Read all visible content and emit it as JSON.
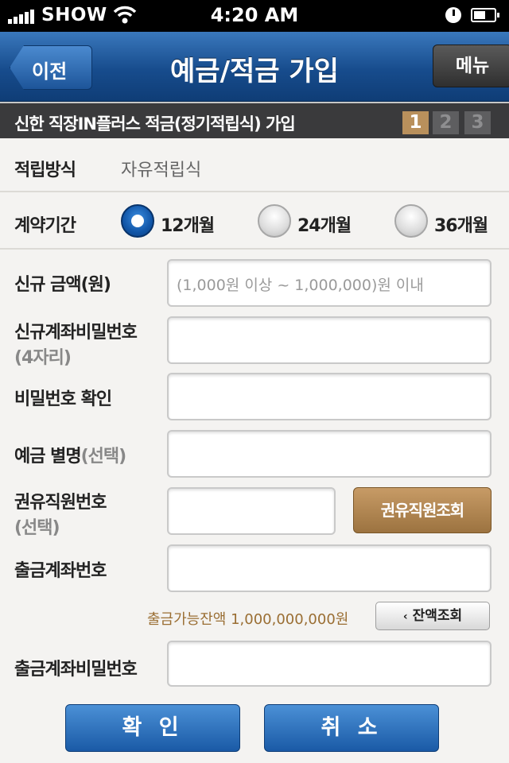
{
  "status_bar": {
    "carrier": "SHOW",
    "time": "4:20 AM"
  },
  "nav": {
    "back_label": "이전",
    "title": "예금/적금 가입",
    "menu_label": "메뉴"
  },
  "subheader": {
    "title": "신한 직장IN플러스 적금(정기적립식) 가입",
    "steps": [
      "1",
      "2",
      "3"
    ],
    "active_step": "1"
  },
  "form": {
    "method_label": "적립방식",
    "method_value": "자유적립식",
    "period_label": "계약기간",
    "period_options": [
      "12개월",
      "24개월",
      "36개월"
    ],
    "period_selected": "12개월",
    "amount_label": "신규 금액(원)",
    "amount_placeholder": "(1,000원 이상 ~ 1,000,000)원 이내",
    "new_pw_label": "신규계좌비밀번호",
    "new_pw_sub": "(4자리)",
    "pw_confirm_label": "비밀번호 확인",
    "nickname_label": "예금 별명",
    "nickname_sub": "(선택)",
    "staff_label": "권유직원번호",
    "staff_sub": "(선택)",
    "staff_search_button": "권유직원조회",
    "withdraw_account_label": "출금계좌번호",
    "balance_text": "출금가능잔액 1,000,000,000원",
    "balance_button": "잔액조회",
    "withdraw_pw_label": "출금계좌비밀번호"
  },
  "actions": {
    "confirm": "확 인",
    "cancel": "취 소"
  },
  "colors": {
    "nav_blue": "#174c8d",
    "brown_accent": "#b9905c",
    "balance_text": "#9a6e33"
  }
}
